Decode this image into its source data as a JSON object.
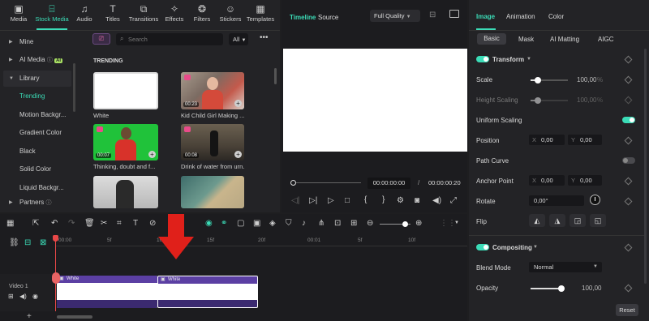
{
  "toolbar": {
    "tabs": [
      {
        "label": "Media",
        "icon": "media-icon"
      },
      {
        "label": "Stock Media",
        "icon": "stock-media-icon"
      },
      {
        "label": "Audio",
        "icon": "audio-icon"
      },
      {
        "label": "Titles",
        "icon": "titles-icon"
      },
      {
        "label": "Transitions",
        "icon": "transitions-icon"
      },
      {
        "label": "Effects",
        "icon": "effects-icon"
      },
      {
        "label": "Filters",
        "icon": "filters-icon"
      },
      {
        "label": "Stickers",
        "icon": "stickers-icon"
      },
      {
        "label": "Templates",
        "icon": "templates-icon"
      }
    ]
  },
  "sidebar": {
    "mine": "Mine",
    "ai_media": "AI Media",
    "ai_badge": "AI",
    "library": "Library",
    "items": [
      "Trending",
      "Motion Backgr...",
      "Gradient Color",
      "Black",
      "Solid Color",
      "Liquid Backgr..."
    ],
    "partners": "Partners"
  },
  "browser": {
    "search_placeholder": "Search",
    "filter": "All",
    "section": "TRENDING",
    "items": [
      {
        "caption": "White",
        "duration": ""
      },
      {
        "caption": "Kid Child Girl Making ...",
        "duration": "00:23"
      },
      {
        "caption": "Thinking, doubt and f...",
        "duration": "00:07"
      },
      {
        "caption": "Drink of water from urn.",
        "duration": "00:08"
      }
    ]
  },
  "preview": {
    "tab_timeline": "Timeline",
    "tab_source": "Source",
    "quality": "Full Quality",
    "current_time": "00:00:00:00",
    "separator": "/",
    "total_time": "00:00:00:20"
  },
  "inspector": {
    "tabs": [
      "Image",
      "Animation",
      "Color"
    ],
    "subtabs": [
      "Basic",
      "Mask",
      "AI Matting",
      "AIGC"
    ],
    "transform": "Transform",
    "scale_label": "Scale",
    "scale_value": "100,00",
    "scale_unit": "%",
    "height_scaling_label": "Height Scaling",
    "height_scaling_value": "100,00",
    "height_scaling_unit": "%",
    "uniform_scaling_label": "Uniform Scaling",
    "position_label": "Position",
    "position_x_key": "X",
    "position_x": "0,00",
    "position_y_key": "Y",
    "position_y": "0,00",
    "path_curve_label": "Path Curve",
    "anchor_label": "Anchor Point",
    "anchor_x_key": "X",
    "anchor_x": "0,00",
    "anchor_y_key": "Y",
    "anchor_y": "0,00",
    "rotate_label": "Rotate",
    "rotate_value": "0,00°",
    "flip_label": "Flip",
    "compositing": "Compositing",
    "blend_label": "Blend Mode",
    "blend_value": "Normal",
    "opacity_label": "Opacity",
    "opacity_value": "100,00",
    "reset": "Reset",
    "scale_level": 0.2,
    "height_scaling_level": 0.2,
    "opacity_level": 1.0
  },
  "timeline": {
    "ruler": [
      "00:00",
      "5f",
      "10f",
      "15f",
      "20f",
      "00:01",
      "5f",
      "10f"
    ],
    "track_label": "Video 1",
    "clip1_label": "White",
    "clip2_label": "White"
  },
  "colors": {
    "accent": "#3bdcb7",
    "clip": "#5b3fa3",
    "arrow": "#e0201a"
  }
}
